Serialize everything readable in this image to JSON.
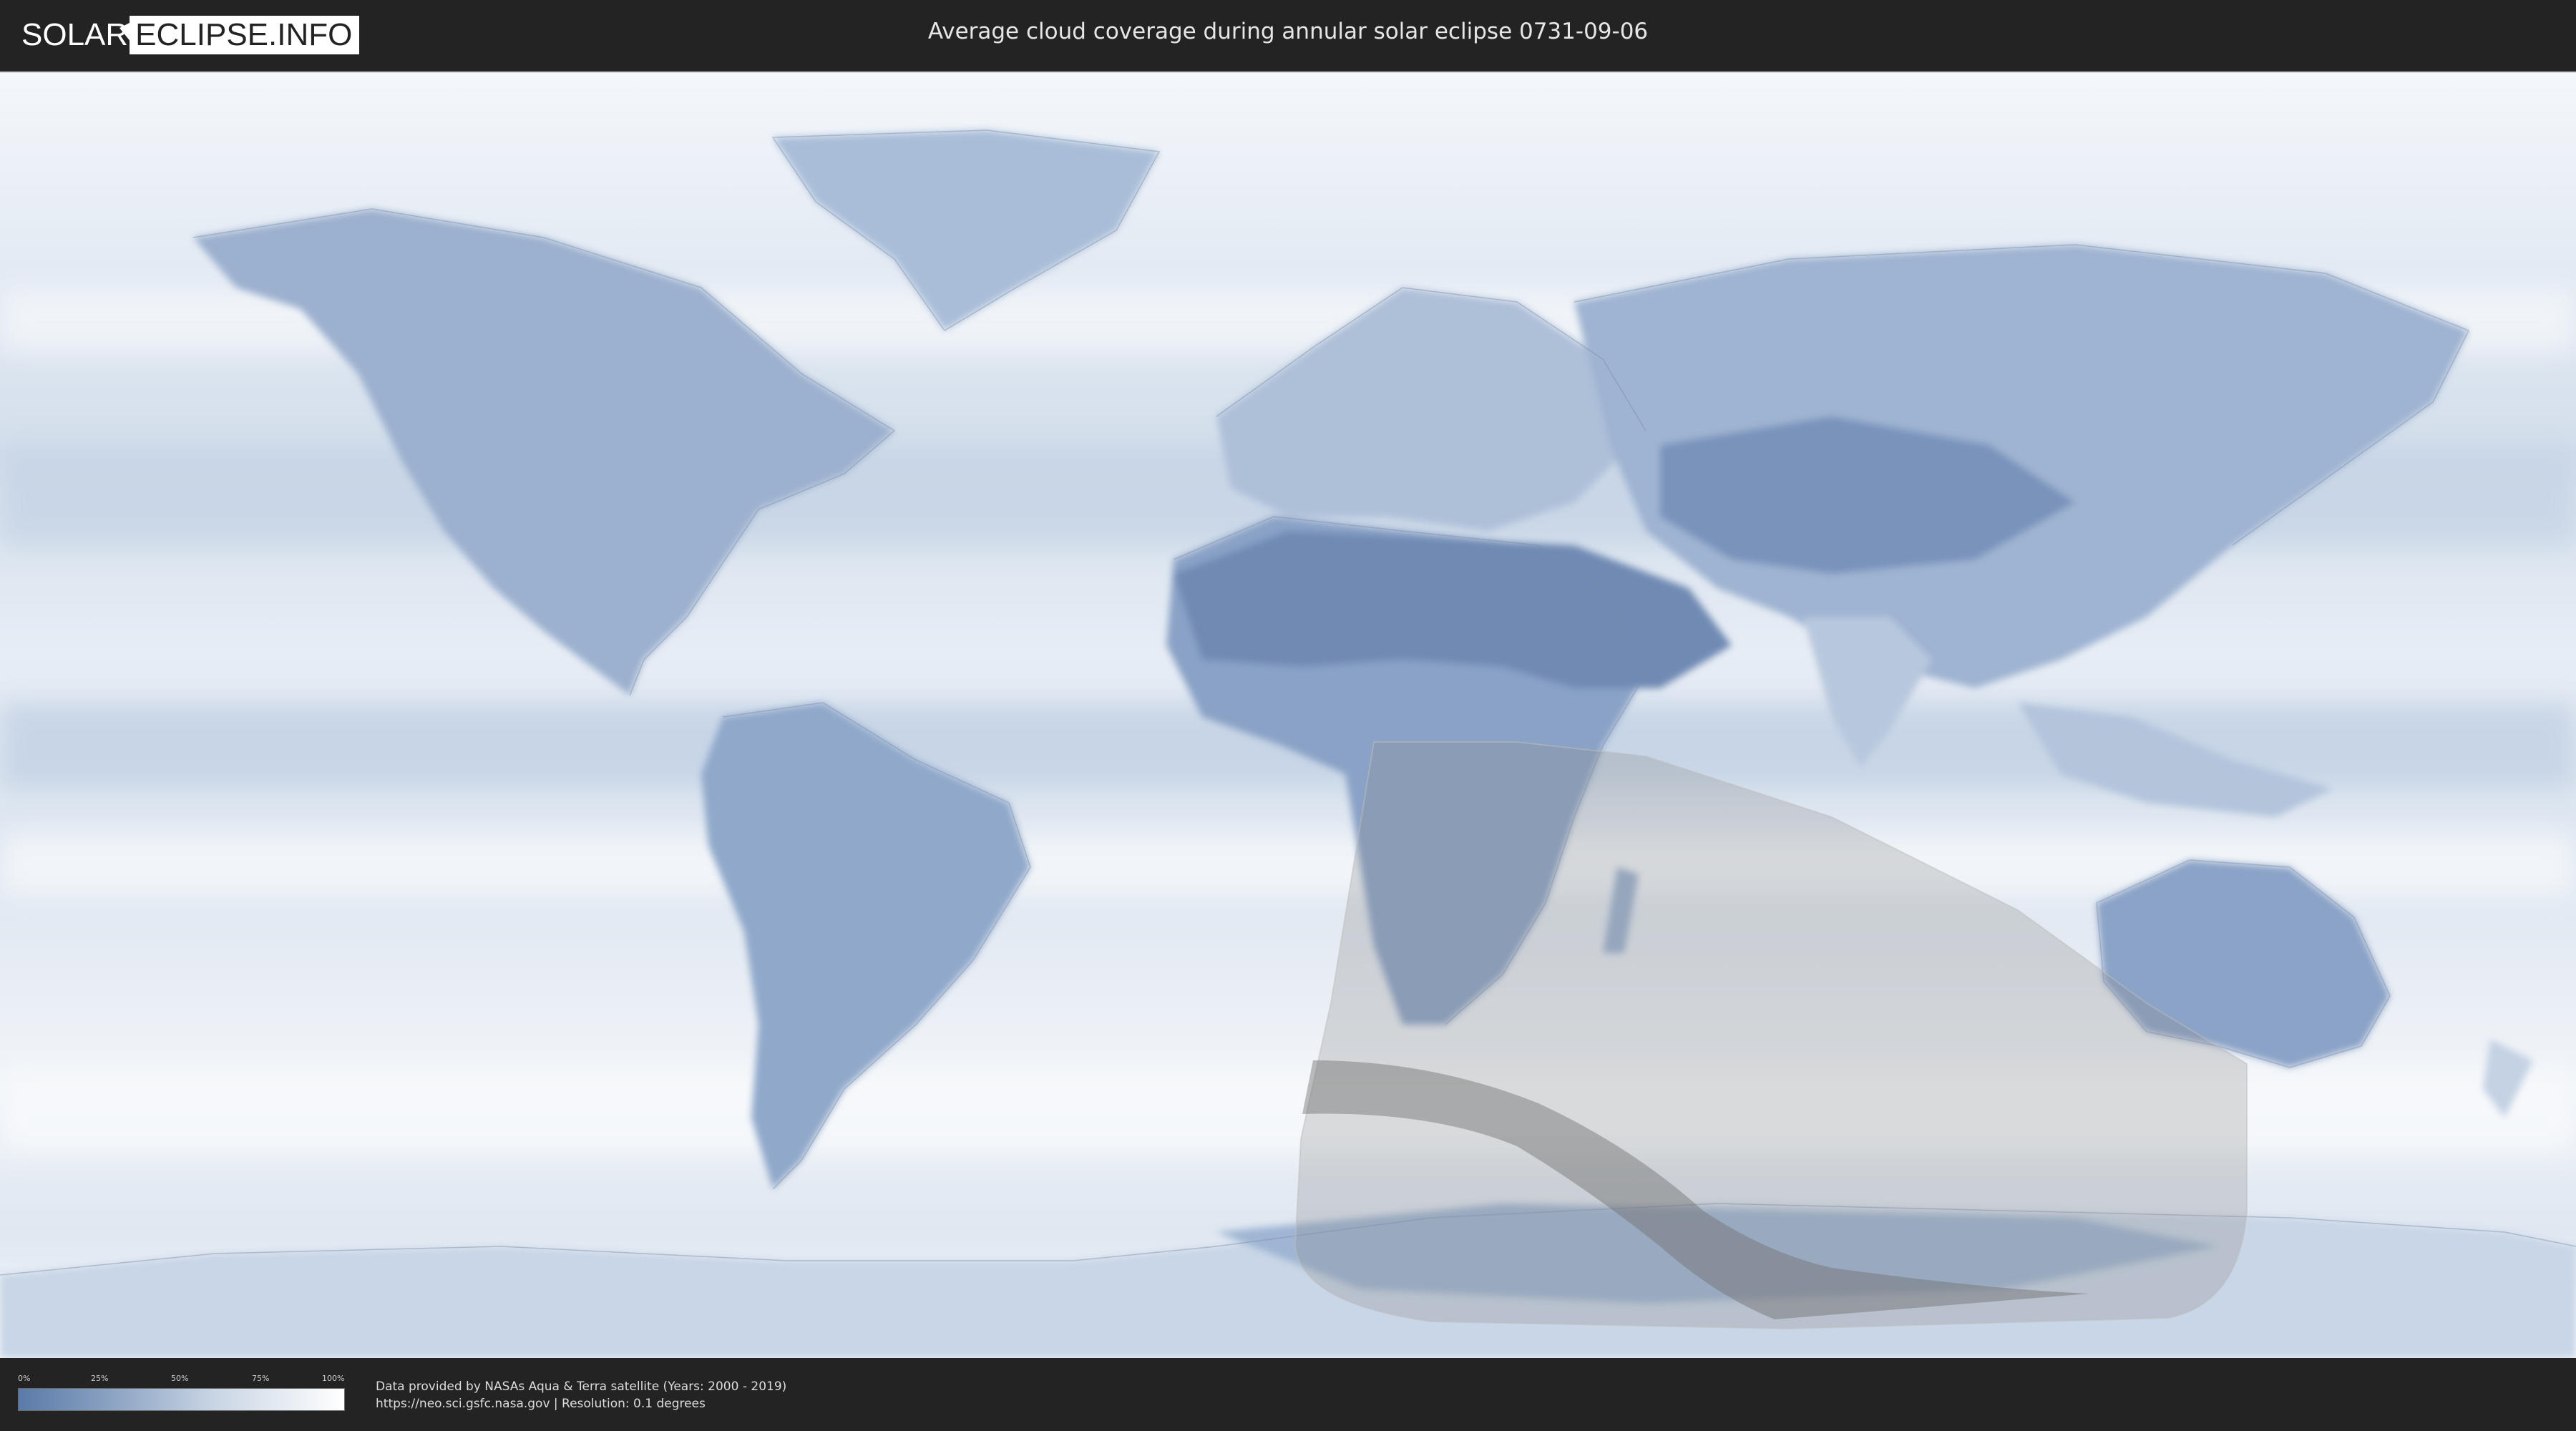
{
  "header": {
    "logo_part1": "SOLAR",
    "logo_part2": "ECLIPSE.INFO",
    "title": "Average cloud coverage during annular solar eclipse 0731-09-06"
  },
  "map": {
    "description_layer": "cloud coverage",
    "colors": {
      "ocean_cloud": "#e9eef5",
      "land_clear": "#6f8ab3",
      "shadow_zone": "#9d9d9d",
      "central_path": "#6b6b6b"
    }
  },
  "legend": {
    "ticks": [
      "0%",
      "25%",
      "50%",
      "75%",
      "100%"
    ],
    "gradient_from": "#5a7aa8",
    "gradient_to": "#ffffff"
  },
  "footer": {
    "credit_line": "Data provided by NASAs Aqua & Terra satellite (Years: 2000 - 2019)",
    "source_line": "https://neo.sci.gsfc.nasa.gov | Resolution: 0.1 degrees"
  }
}
